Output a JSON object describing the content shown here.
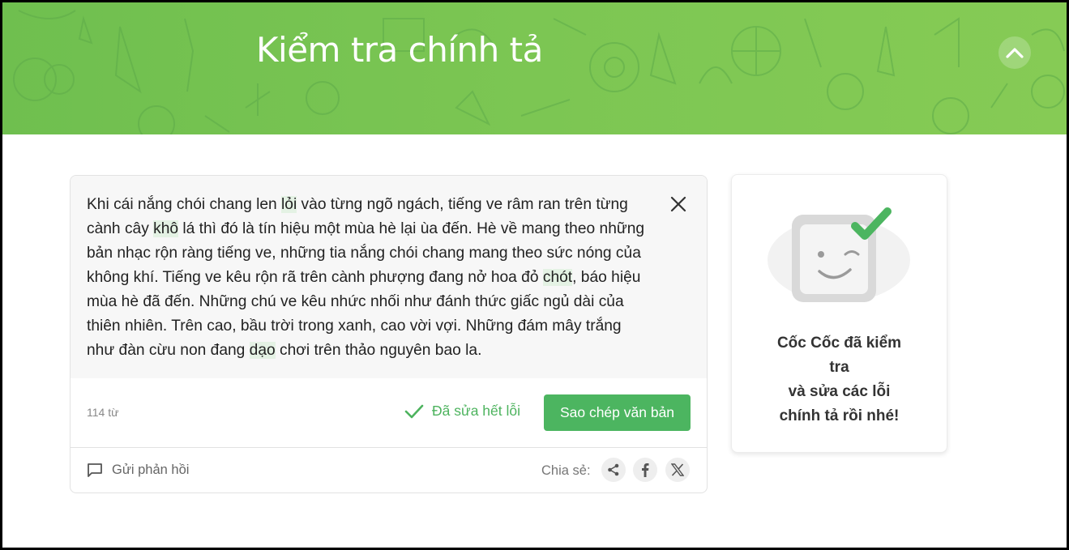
{
  "header": {
    "title": "Kiểm tra chính tả",
    "collapse_icon": "chevron-up-icon"
  },
  "editor": {
    "text_segments": [
      {
        "text": "Khi cái nắng chói chang len ",
        "highlight": false
      },
      {
        "text": "lỏi",
        "highlight": true
      },
      {
        "text": " vào từng ngõ ngách, tiếng ve râm ran trên từng cành cây ",
        "highlight": false
      },
      {
        "text": "khô",
        "highlight": true
      },
      {
        "text": " lá thì đó là tín hiệu một mùa hè lại ùa đến. Hè về mang theo những bản nhạc rộn ràng tiếng ve, những tia nắng chói chang mang theo sức nóng của không khí. Tiếng ve kêu rộn rã trên cành phượng đang nở hoa đỏ ",
        "highlight": false
      },
      {
        "text": "chót",
        "highlight": true
      },
      {
        "text": ", báo hiệu mùa hè đã đến. Những chú ve kêu nhức nhối như đánh thức giấc ngủ dài của thiên nhiên. Trên cao, bầu trời trong xanh, cao vời vợi. Những đám mây trắng như đàn cừu non đang ",
        "highlight": false
      },
      {
        "text": "dạo",
        "highlight": true
      },
      {
        "text": " chơi trên thảo nguyên bao la.",
        "highlight": false
      }
    ],
    "close_icon": "close-icon",
    "word_count": "114 từ",
    "fixed_status": "Đã sửa hết lỗi",
    "copy_button": "Sao chép văn bản",
    "feedback_label": "Gửi phản hồi",
    "share_label": "Chia sẻ:",
    "share_icons": [
      "share-icon",
      "facebook-icon",
      "x-icon"
    ]
  },
  "result": {
    "message_lines": [
      "Cốc Cốc đã kiểm",
      "tra",
      "và sửa các lỗi",
      "chính tả rồi nhé!"
    ]
  },
  "colors": {
    "header_green": "#7cc653",
    "accent_green": "#4cb560",
    "highlight_bg": "#e4f2e4"
  }
}
